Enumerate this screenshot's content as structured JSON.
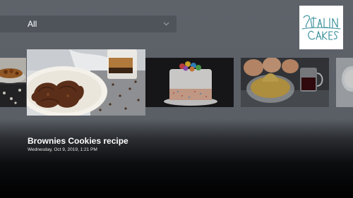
{
  "filter": {
    "selected": "All"
  },
  "brand": {
    "logo_text": "ITALIAN CAKES",
    "logo_color": "#2e8a95"
  },
  "carousel": {
    "items": [
      {
        "kind": "cookies-bowl"
      },
      {
        "kind": "brownies-cookies",
        "focused": true
      },
      {
        "kind": "sprinkle-cake"
      },
      {
        "kind": "cream-and-eggs"
      },
      {
        "kind": "partial-next"
      }
    ]
  },
  "details": {
    "title": "Brownies Cookies recipe",
    "subtitle": "Wednesday, Oct 9, 2019, 1:21 PM"
  },
  "colors": {
    "background": "#5c6168",
    "filter_bar": "#4f545b",
    "text": "#ffffff"
  }
}
